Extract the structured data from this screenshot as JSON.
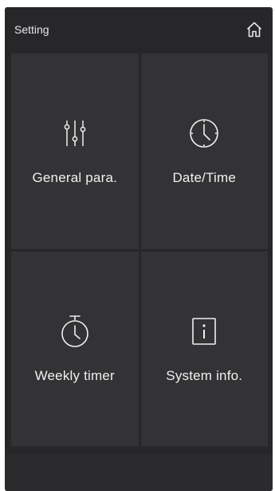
{
  "header": {
    "title": "Setting"
  },
  "tiles": [
    {
      "label": "General para.",
      "icon": "sliders-icon"
    },
    {
      "label": "Date/Time",
      "icon": "clock-icon"
    },
    {
      "label": "Weekly timer",
      "icon": "stopwatch-icon"
    },
    {
      "label": "System info.",
      "icon": "info-icon"
    }
  ],
  "colors": {
    "background": "#27272a",
    "tile": "#333335",
    "text": "#f0f0f0"
  }
}
